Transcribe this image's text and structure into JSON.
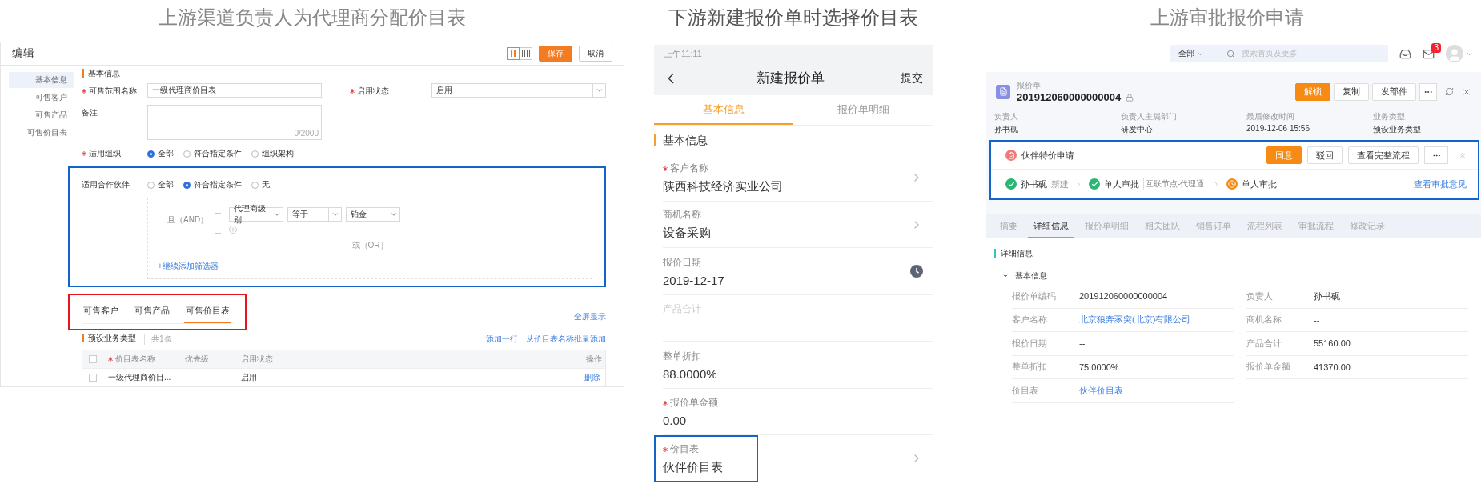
{
  "left": {
    "caption": "上游渠道负责人为代理商分配价目表",
    "title": "编辑",
    "view_toggle": [
      {
        "kind": "two",
        "selected": true
      },
      {
        "kind": "four",
        "selected": false
      }
    ],
    "buttons": [
      {
        "label": "保存",
        "primary": true
      },
      {
        "label": "取消",
        "primary": false
      }
    ],
    "nav": [
      {
        "label": "基本信息",
        "selected": true
      },
      {
        "label": "可售客户",
        "selected": false
      },
      {
        "label": "可售产品",
        "selected": false
      },
      {
        "label": "可售价目表",
        "selected": false
      }
    ],
    "section": "基本信息",
    "name_field": {
      "label": "可售范围名称",
      "required": true,
      "value": "一级代理商价目表"
    },
    "status_field": {
      "label": "启用状态",
      "required": true,
      "value": "启用"
    },
    "note_field": {
      "label": "备注",
      "counter": "0/2000"
    },
    "org": {
      "label": "适用组织",
      "required": true,
      "options": [
        {
          "label": "全部",
          "selected": true
        },
        {
          "label": "符合指定条件",
          "selected": false
        },
        {
          "label": "组织架构",
          "selected": false
        }
      ]
    },
    "partner": {
      "label": "适用合作伙伴",
      "required": false,
      "annotated": true,
      "options": [
        {
          "label": "全部",
          "selected": false
        },
        {
          "label": "符合指定条件",
          "selected": true
        },
        {
          "label": "无",
          "selected": false
        }
      ],
      "filter": {
        "and_label": "且（AND）",
        "conditions": [
          "代理商级别",
          "等于",
          "铂金"
        ],
        "or_label": "或（OR）",
        "add_link": "+继续添加筛选器"
      }
    },
    "tabs_annotated": true,
    "tabs": [
      {
        "label": "可售客户",
        "selected": false
      },
      {
        "label": "可售产品",
        "selected": false
      },
      {
        "label": "可售价目表",
        "selected": true
      }
    ],
    "fullscreen_link": "全屏显示",
    "table_section": {
      "title": "预设业务类型",
      "count": "共1条",
      "actions": [
        "添加一行",
        "从价目表名称批量添加"
      ]
    },
    "table": {
      "header_checked": false,
      "columns": [
        {
          "label": "价目表名称",
          "required": true
        },
        {
          "label": "优先级",
          "required": false
        },
        {
          "label": "启用状态",
          "required": false
        },
        {
          "label": "操作",
          "required": false
        }
      ],
      "rows": [
        {
          "checked": false,
          "cells": [
            "一级代理商价目...",
            "--",
            "启用"
          ],
          "action": "删除"
        }
      ]
    }
  },
  "middle": {
    "caption": "下游新建报价单时选择价目表",
    "status_time": "上午11:11",
    "title": "新建报价单",
    "submit": "提交",
    "tabs": [
      {
        "label": "基本信息",
        "selected": true
      },
      {
        "label": "报价单明细",
        "selected": false
      }
    ],
    "section": "基本信息",
    "fields": [
      {
        "label": "客户名称",
        "required": true,
        "value": "陕西科技经济实业公司",
        "kind": "select",
        "disabled": false,
        "annotated": false
      },
      {
        "label": "商机名称",
        "required": false,
        "value": "设备采购",
        "kind": "select",
        "disabled": false,
        "annotated": false
      },
      {
        "label": "报价日期",
        "required": false,
        "value": "2019-12-17",
        "kind": "date",
        "disabled": false,
        "annotated": false
      },
      {
        "label": "产品合计",
        "required": false,
        "kind": "text",
        "disabled": true,
        "annotated": false
      },
      {
        "label": "整单折扣",
        "required": false,
        "value": "88.0000%",
        "kind": "text",
        "disabled": false,
        "annotated": false
      },
      {
        "label": "报价单金额",
        "required": true,
        "value": "0.00",
        "kind": "text",
        "disabled": false,
        "annotated": false
      },
      {
        "label": "价目表",
        "required": true,
        "value": "伙伴价目表",
        "kind": "select",
        "disabled": false,
        "annotated": true
      }
    ]
  },
  "right": {
    "caption": "上游审批报价申请",
    "scope": "全部",
    "search_placeholder": "搜索首页及更多",
    "mail_badge": "3",
    "record": {
      "type_label": "报价单",
      "number": "201912060000000004",
      "locked": true,
      "buttons": [
        {
          "label": "解锁",
          "primary": true
        },
        {
          "label": "复制",
          "primary": false
        },
        {
          "label": "发部件",
          "primary": false
        }
      ]
    },
    "info": [
      {
        "label": "负责人",
        "value": "孙书砚"
      },
      {
        "label": "负责人主属部门",
        "value": "研发中心"
      },
      {
        "label": "最后修改时间",
        "value": "2019-12-06 15:56"
      },
      {
        "label": "业务类型",
        "value": "预设业务类型"
      }
    ],
    "approval": {
      "annotated": true,
      "title": "伙伴特价申请",
      "buttons": [
        {
          "label": "同意",
          "primary": true
        },
        {
          "label": "驳回",
          "primary": false
        },
        {
          "label": "查看完整流程",
          "primary": false
        }
      ],
      "steps": [
        {
          "kind": "done",
          "name": "孙书砚",
          "note": "新建"
        },
        {
          "kind": "done",
          "name": "单人审批",
          "tag": "互联节点-代理通"
        },
        {
          "kind": "current",
          "name": "单人审批"
        }
      ],
      "link": "查看审批意见"
    },
    "tabs": [
      {
        "label": "摘要",
        "selected": false
      },
      {
        "label": "详细信息",
        "selected": true
      },
      {
        "label": "报价单明细",
        "selected": false
      },
      {
        "label": "相关团队",
        "selected": false
      },
      {
        "label": "销售订单",
        "selected": false
      },
      {
        "label": "流程列表",
        "selected": false
      },
      {
        "label": "审批流程",
        "selected": false
      },
      {
        "label": "修改记录",
        "selected": false
      }
    ],
    "detail_title": "详细信息",
    "group": {
      "title": "基本信息",
      "expanded": true,
      "fields": [
        {
          "label": "报价单编码",
          "value": "201912060000000004",
          "link": false
        },
        {
          "label": "负责人",
          "value": "孙书砚",
          "link": false
        },
        {
          "label": "客户名称",
          "value": "北京狼奔豕突(北京)有限公司",
          "link": true
        },
        {
          "label": "商机名称",
          "value": "--",
          "link": false
        },
        {
          "label": "报价日期",
          "value": "--",
          "link": false
        },
        {
          "label": "产品合计",
          "value": "55160.00",
          "link": false
        },
        {
          "label": "整单折扣",
          "value": "75.0000%",
          "link": false
        },
        {
          "label": "报价单金额",
          "value": "41370.00",
          "link": false
        },
        {
          "label": "价目表",
          "value": "伙伴价目表",
          "link": true
        }
      ]
    }
  }
}
